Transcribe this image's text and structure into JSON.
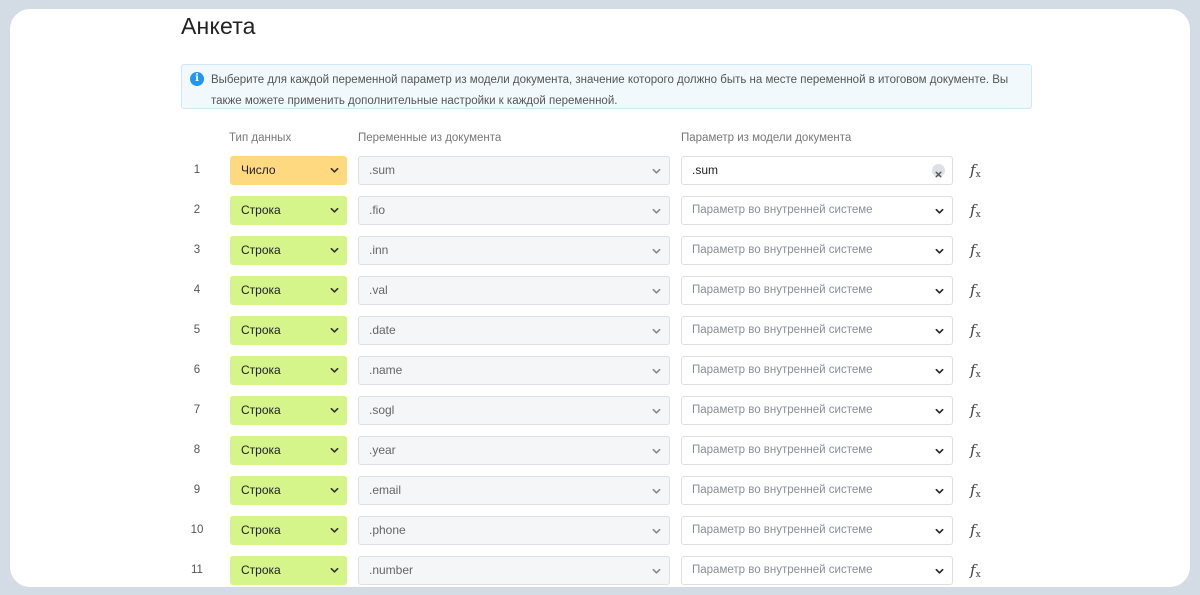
{
  "page": {
    "title": "Анкета",
    "info_text": "Выберите для каждой переменной параметр из модели документа, значение которого должно быть на месте переменной в итоговом документе. Вы также можете применить дополнительные настройки к каждой переменной.",
    "info_icon": "info-icon",
    "info_icon_color": "#2196f3"
  },
  "columns": {
    "type": "Тип данных",
    "variables": "Переменные из документа",
    "param": "Параметр из модели документа"
  },
  "colors": {
    "type_number_bg": "#ffd97f",
    "type_string_bg": "#d5f48a"
  },
  "rows": [
    {
      "num": "1",
      "type": "Число",
      "type_kind": "chislo",
      "variable": ".sum",
      "param": ".sum",
      "param_filled": true
    },
    {
      "num": "2",
      "type": "Строка",
      "type_kind": "stroka",
      "variable": ".fio",
      "param": "Параметр во внутренней системе",
      "param_filled": false
    },
    {
      "num": "3",
      "type": "Строка",
      "type_kind": "stroka",
      "variable": ".inn",
      "param": "Параметр во внутренней системе",
      "param_filled": false
    },
    {
      "num": "4",
      "type": "Строка",
      "type_kind": "stroka",
      "variable": ".val",
      "param": "Параметр во внутренней системе",
      "param_filled": false
    },
    {
      "num": "5",
      "type": "Строка",
      "type_kind": "stroka",
      "variable": ".date",
      "param": "Параметр во внутренней системе",
      "param_filled": false
    },
    {
      "num": "6",
      "type": "Строка",
      "type_kind": "stroka",
      "variable": ".name",
      "param": "Параметр во внутренней системе",
      "param_filled": false
    },
    {
      "num": "7",
      "type": "Строка",
      "type_kind": "stroka",
      "variable": ".sogl",
      "param": "Параметр во внутренней системе",
      "param_filled": false
    },
    {
      "num": "8",
      "type": "Строка",
      "type_kind": "stroka",
      "variable": ".year",
      "param": "Параметр во внутренней системе",
      "param_filled": false
    },
    {
      "num": "9",
      "type": "Строка",
      "type_kind": "stroka",
      "variable": ".email",
      "param": "Параметр во внутренней системе",
      "param_filled": false
    },
    {
      "num": "10",
      "type": "Строка",
      "type_kind": "stroka",
      "variable": ".phone",
      "param": "Параметр во внутренней системе",
      "param_filled": false
    },
    {
      "num": "11",
      "type": "Строка",
      "type_kind": "stroka",
      "variable": ".number",
      "param": "Параметр во внутренней системе",
      "param_filled": false
    }
  ],
  "icons": {
    "chevron": "chevron-down-icon",
    "clear": "clear-icon",
    "formula": "formula-icon"
  }
}
